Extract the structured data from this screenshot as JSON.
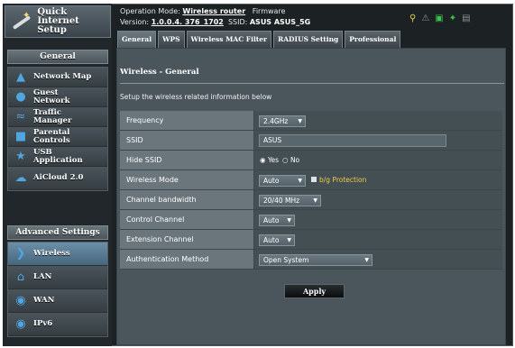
{
  "sidebar": {
    "qis_label_1": "Quick Internet",
    "qis_label_2": "Setup",
    "general_header": "General",
    "general_items": [
      {
        "label": "Network Map",
        "icon": "network-map-icon"
      },
      {
        "label_1": "Guest",
        "label_2": "Network",
        "icon": "guest-network-icon"
      },
      {
        "label_1": "Traffic",
        "label_2": "Manager",
        "icon": "traffic-manager-icon"
      },
      {
        "label_1": "Parental",
        "label_2": "Controls",
        "icon": "parental-controls-icon"
      },
      {
        "label_1": "USB",
        "label_2": "Application",
        "icon": "usb-icon"
      },
      {
        "label": "AiCloud 2.0",
        "icon": "cloud-icon"
      }
    ],
    "advanced_header": "Advanced Settings",
    "advanced_items": [
      {
        "label": "Wireless",
        "icon": "wireless-icon",
        "active": true
      },
      {
        "label": "LAN",
        "icon": "home-icon"
      },
      {
        "label": "WAN",
        "icon": "globe-icon"
      },
      {
        "label": "IPv6",
        "icon": "ipv6-icon"
      }
    ]
  },
  "header": {
    "op_mode_label": "Operation Mode:",
    "op_mode_value": "Wireless router",
    "firmware_label": "Firmware",
    "version_label": "Version:",
    "version_value": "1.0.0.4. 376_1702",
    "ssid_label": "SSID:",
    "ssid_value": "ASUS  ASUS_5G"
  },
  "tabs": [
    "General",
    "WPS",
    "Wireless MAC Filter",
    "RADIUS Setting",
    "Professional"
  ],
  "content": {
    "title": "Wireless - General",
    "description": "Setup the wireless related information below",
    "fields": {
      "frequency": {
        "label": "Frequency",
        "value": "2.4GHz"
      },
      "ssid": {
        "label": "SSID",
        "value": "ASUS"
      },
      "hide_ssid": {
        "label": "Hide SSID",
        "yes": "Yes",
        "no": "No"
      },
      "wireless_mode": {
        "label": "Wireless Mode",
        "value": "Auto",
        "bg_protection": "b/g Protection"
      },
      "channel_bandwidth": {
        "label": "Channel bandwidth",
        "value": "20/40 MHz"
      },
      "control_channel": {
        "label": "Control Channel",
        "value": "Auto"
      },
      "extension_channel": {
        "label": "Extension Channel",
        "value": "Auto"
      },
      "auth_method": {
        "label": "Authentication Method",
        "value": "Open System"
      }
    },
    "apply_label": "Apply"
  },
  "colors": {
    "background": "#1c2124",
    "panel": "#4b565c",
    "label_cell": "#6a767c",
    "value_cell": "#444f54",
    "accent_blue": "#4fa6e0",
    "bg_protection_text": "#f2c94c"
  }
}
